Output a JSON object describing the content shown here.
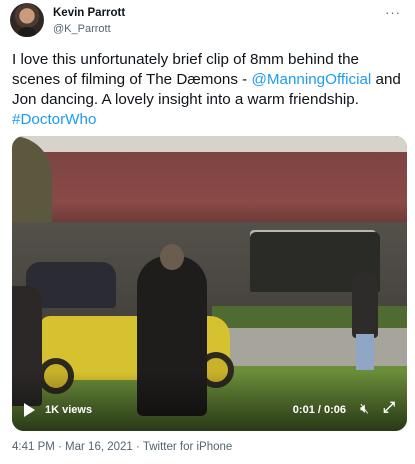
{
  "author": {
    "name": "Kevin Parrott",
    "handle": "@K_Parrott",
    "avatar_icon": "user-avatar"
  },
  "menu": {
    "more_icon": "more-horizontal-icon",
    "more_label": "···"
  },
  "tweet": {
    "text_before": "I love this unfortunately brief clip of 8mm behind the scenes of filming of The Dæmons - ",
    "mention": "@ManningOfficial",
    "text_middle": " and Jon dancing. A lovely insight into a warm friendship. ",
    "hashtag": "#DoctorWho"
  },
  "video": {
    "views": "1K views",
    "time": "0:01 / 0:06",
    "play_icon": "play-icon",
    "mute_icon": "volume-mute-icon",
    "mute_label": "🔇︎",
    "expand_icon": "fullscreen-icon",
    "expand_label": "⤢"
  },
  "meta": {
    "timestamp": "4:41 PM · Mar 16, 2021 · Twitter for iPhone"
  },
  "colors": {
    "link": "#1d9bf0",
    "text": "#0f1419",
    "secondary": "#536471"
  }
}
